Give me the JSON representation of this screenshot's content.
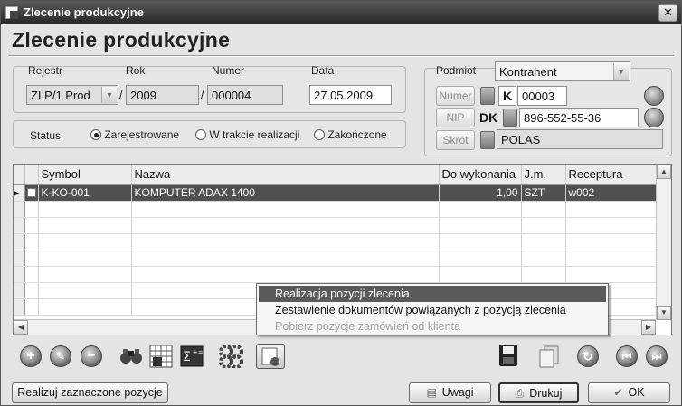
{
  "window": {
    "title": "Zlecenie produkcyjne",
    "close_glyph": "✕"
  },
  "page_title": "Zlecenie produkcyjne",
  "header": {
    "rejestr_label": "Rejestr",
    "rejestr_value": "ZLP/1  Prod",
    "rok_label": "Rok",
    "rok_value": "2009",
    "numer_label": "Numer",
    "numer_value": "000004",
    "data_label": "Data",
    "data_value": "27.05.2009",
    "separator": "/"
  },
  "status": {
    "label": "Status",
    "options": [
      "Zarejestrowane",
      "W trakcie realizacji",
      "Zakończone"
    ],
    "selected_index": 0
  },
  "podmiot": {
    "label": "Podmiot",
    "type_value": "Kontrahent",
    "numer_button": "Numer",
    "numer_letter": "K",
    "numer_value": "00003",
    "nip_button": "NIP",
    "nip_letter": "DK",
    "nip_value": "896-552-55-36",
    "skrot_button": "Skrót",
    "skrot_value": "POLAS"
  },
  "grid": {
    "columns": [
      "Symbol",
      "Nazwa",
      "Do wykonania",
      "J.m.",
      "Receptura"
    ],
    "rows": [
      {
        "symbol": "K-KO-001",
        "nazwa": "KOMPUTER ADAX 1400",
        "do_wykonania": "1,00",
        "jm": "SZT",
        "receptura": "w002"
      }
    ]
  },
  "context_menu": {
    "items": [
      {
        "label": "Realizacja pozycji zlecenia",
        "state": "highlighted"
      },
      {
        "label": "Zestawienie dokumentów powiązanych z pozycją zlecenia",
        "state": "enabled"
      },
      {
        "label": "Pobierz pozycje zamówień od klienta",
        "state": "disabled"
      }
    ]
  },
  "toolbar": {
    "icons": [
      "add-icon",
      "edit-icon",
      "delete-icon",
      "binoculars-icon",
      "calculator-grid-icon",
      "sum-icon",
      "gears-icon",
      "document-menu-icon",
      "save-icon",
      "copy-icon",
      "refresh-icon",
      "prev-icon",
      "next-icon"
    ]
  },
  "footer": {
    "realizuj_label": "Realizuj zaznaczone pozycje",
    "uwagi_label": "Uwagi",
    "drukuj_label": "Drukuj",
    "ok_label": "OK"
  }
}
